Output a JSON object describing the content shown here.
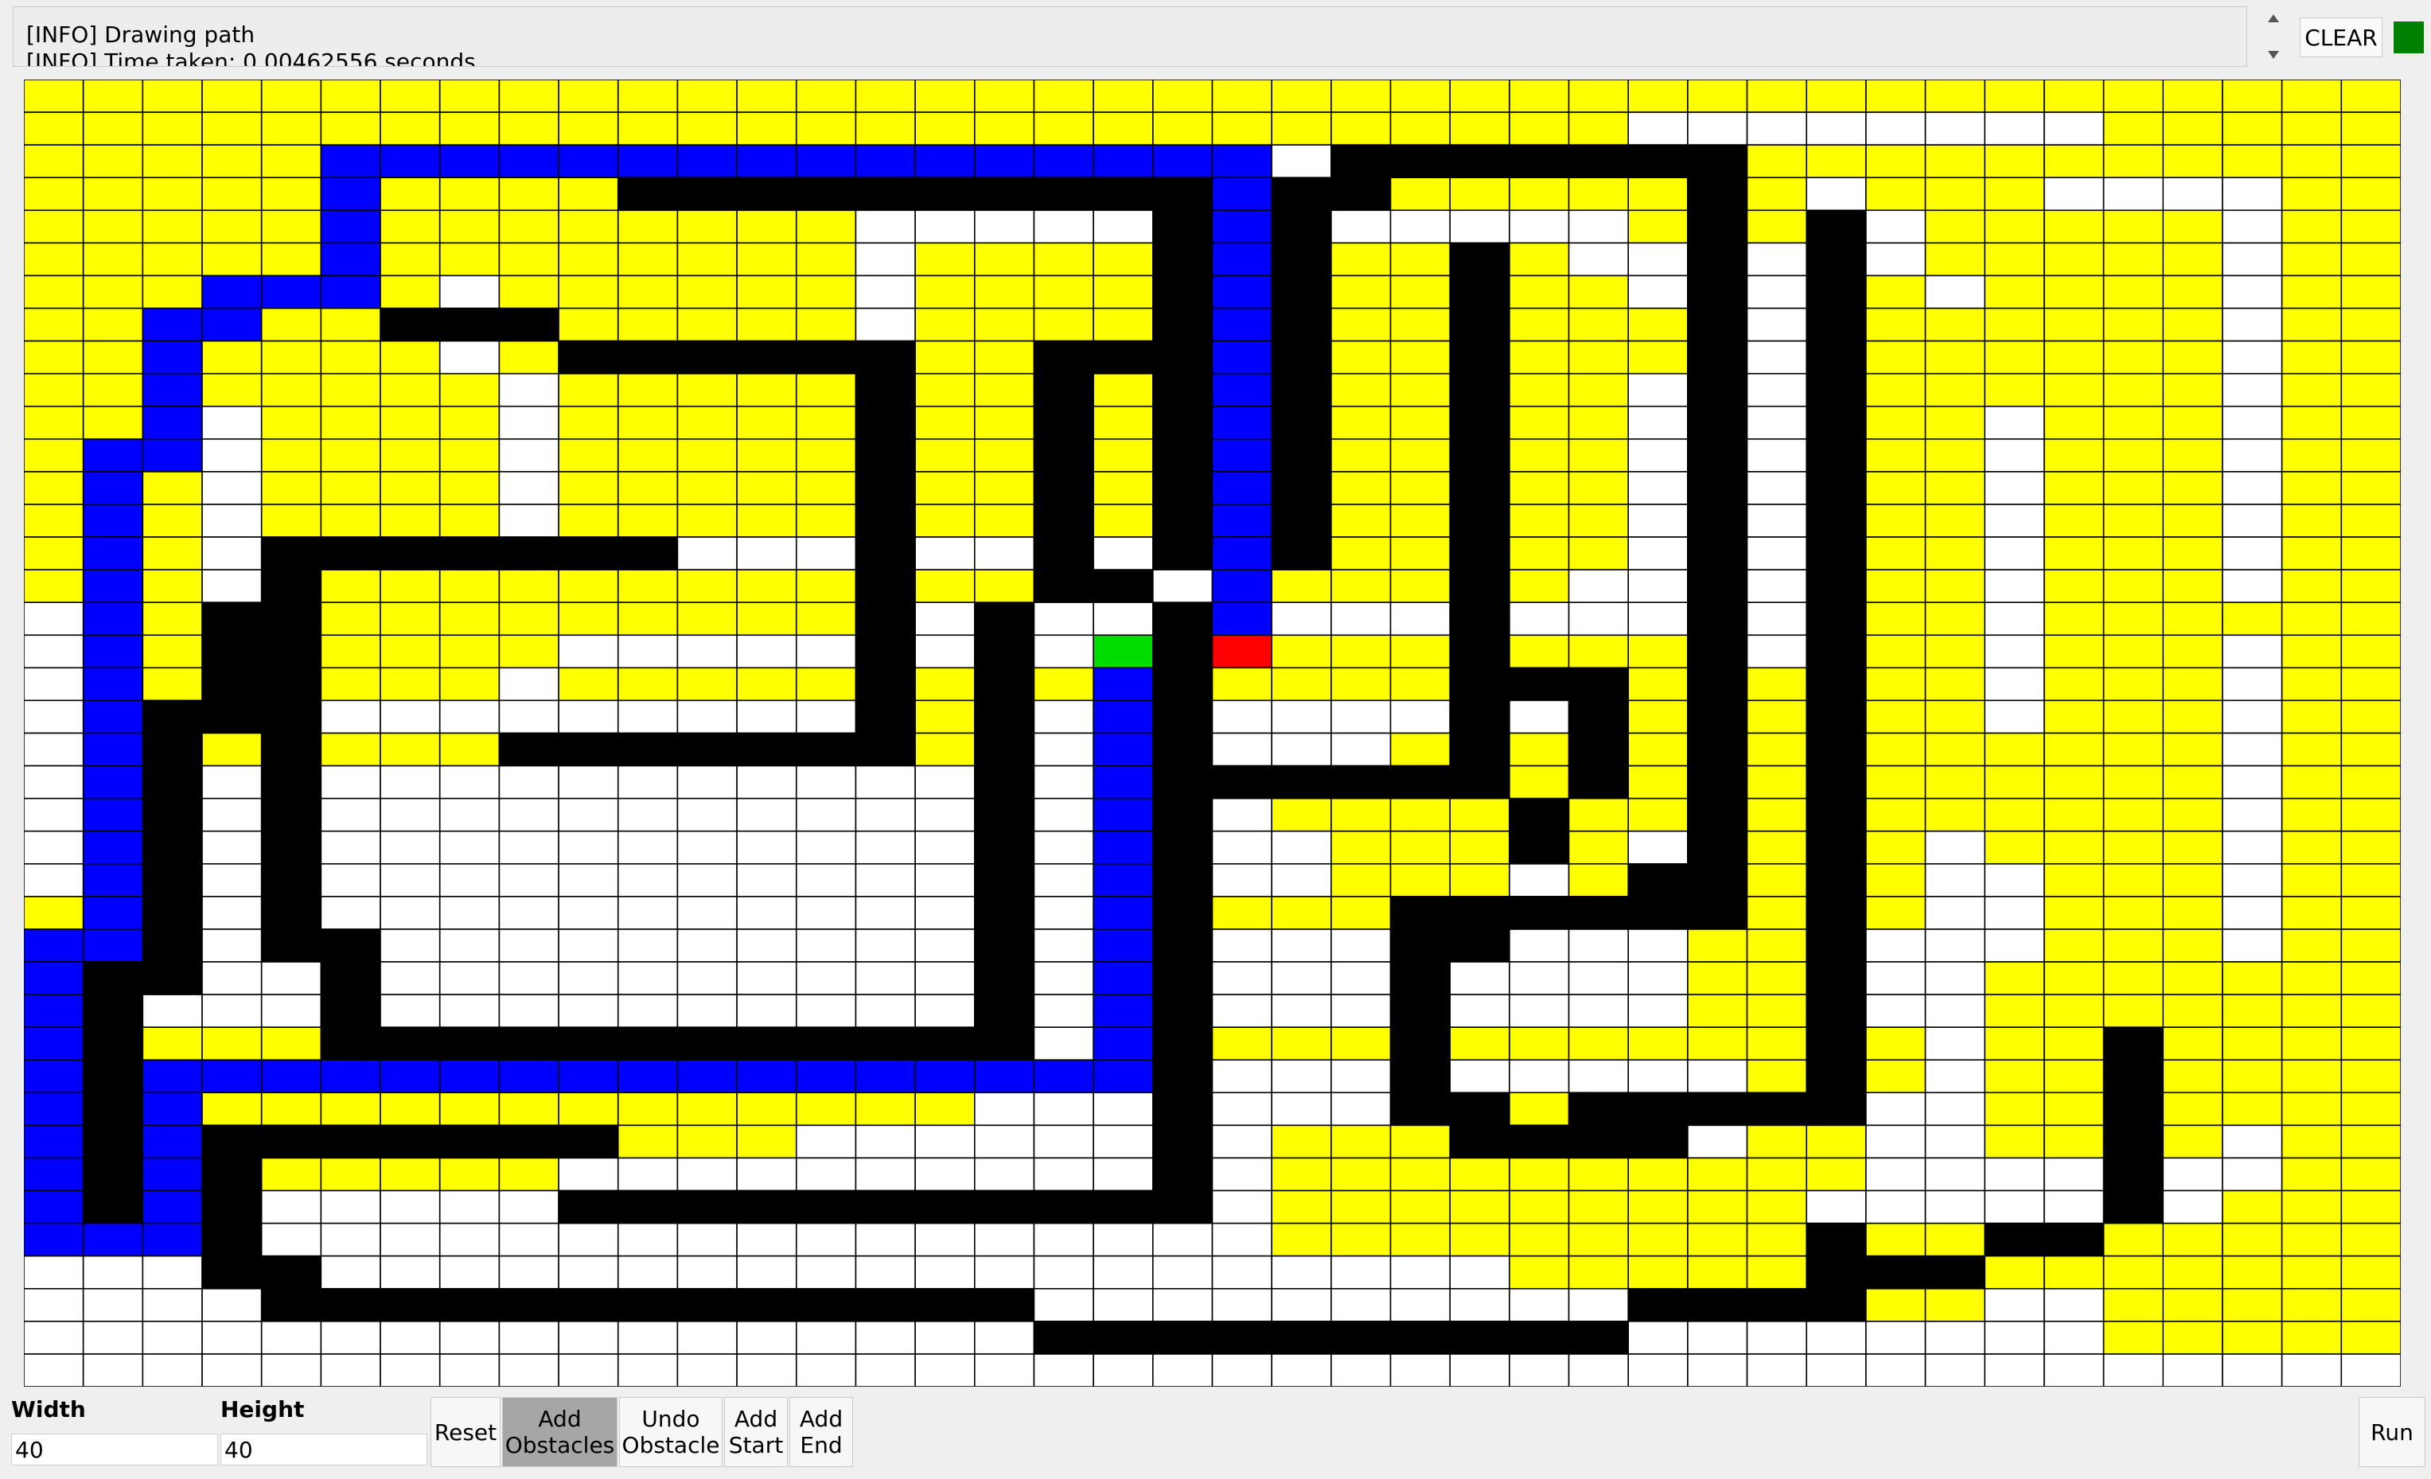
{
  "log": {
    "lines": [
      "[INFO] Drawing path",
      "[INFO] Time taken: 0.00462556 seconds"
    ]
  },
  "toolbar": {
    "clear_label": "CLEAR",
    "status_color": "#008000"
  },
  "controls": {
    "width_label": "Width",
    "width_value": "40",
    "height_label": "Height",
    "height_value": "40",
    "reset_label": "Reset",
    "add_obstacles_line1": "Add",
    "add_obstacles_line2": "Obstacles",
    "undo_line1": "Undo",
    "undo_line2": "Obstacle",
    "add_start_line1": "Add",
    "add_start_line2": "Start",
    "add_end_line1": "Add",
    "add_end_line2": "End",
    "run_label": "Run"
  },
  "grid": {
    "cols": 40,
    "rows": 40,
    "colors": {
      "Y": "#ffff00",
      "W": "#ffffff",
      "K": "#000000",
      "B": "#0000ff",
      "G": "#00dd00",
      "R": "#ff0000"
    },
    "cells": [
      "YYYYYYYYYYYYYYYYYYYYYYYYYYYYYYYYYYYYYYYY",
      "YYYYYYYYYYYYYYYYYYYYYYYYYYYWWWWWWWWYYYYY",
      "YYYYYBBBBBBBBBBBBBBBBWKKKKKKKYYYYYYYYYYY",
      "YYYYYBYYYYKKKKKKKKKKBKKYYYYYKYWYYYWWWWYY",
      "YYYYYBYYYYYYYYWWWWWKBKWWWWWYKYKWYYYYYWYY",
      "YYYYYBYYYYYYYYWYYYYKBKYYKYWWKWKWYYYYYWYY",
      "YYYBBBYWYYYYYYWYYYYKBKYYKYYWKWKYWYYYYWYY",
      "YYBBYYKKKYYYYYWYYYYKBKYYKYYYKWKYYYYYYWYY",
      "YYBYYYYWYKKKKKKYYKKKBKYYKYYYKWKYYYYYYWYY",
      "YYBYYYYYWYYYYYKYYKYKBKYYKYYWKWKYYYYYYWYY",
      "YYBWYYYYWYYYYYKYYKYKBKYYKYYWKWKYYWYYYWYY",
      "YBBWYYYYWYYYYYKYYKYKBKYYKYYWKWKYYWYYYWYY",
      "YBYWYYYYWYYYYYKYYKYKBKYYKYYWKWKYYWYYYWYY",
      "YBYWYYYYWYYYYYKYYKYKBKYYKYYWKWKYYWYYYWYY",
      "YBYWKKKKKKKWWWKWWKWKBKYYKYYWKWKYYWYYYWYY",
      "YBYWKYYYYYYYYYKYYKKWBYYYKYWWKWKYYWYYYWYY",
      "WBYKKYYYYYYYYYKWKWWKBWWWKWWWKWKYYWYYYYYY",
      "WBYKKYYYYWWWWWKWKWGKRYYYKYYYKWKYYWYYYWYY",
      "WBYKKYYYWYYYYYKYKYBKYYYYKKKYKYKYYWYYYWYY",
      "WBKKKWWWWWWWWWKYKWBKWWWWKWKYKYKYYWYYYWYY",
      "WBKYKYYYKKKKKKKYKWBKWWWYKYKYKYKYYYYYYWYY",
      "WBKWKWWWWWWWWWWWKWBKKKKKKYKYKYKYYYYYYWYY",
      "WBKWKWWWWWWWWWWWKWBKWYYYYKYYKYKYYYYYYWYY",
      "WBKWKWWWWWWWWWWWKWBKWWYYYKYWKYKYWYYYYWYY",
      "WBKWKWWWWWWWWWWWKWBKWWYYYWYKKYKYWWYYYWYY",
      "YBKWKWWWWWWWWWWWKWBKYYYKKKKKKYKYWWYYYWYY",
      "BBKWKKWWWWWWWWWWKWBKWWWKKWWWYYKWWWYYYWYY",
      "BKKWWKWWWWWWWWWWKWBKWWWKWWWWYYKWWYYYYYYY",
      "BKWWWKWWWWWWWWWWKWBKWWWKWWWWYYKWWYYYYYYY",
      "BKYYYKKKKKKKKKKKKWBKYYYKYYYYYYKYWYYKYYYY",
      "BKBBBBBBBBBBBBBBBBBKWWWKWWWWWYKYWYYKYYYY",
      "BKBYYYYYYYYYYYYYWWWKWWWKKYKKKKKWWYYKYYYY",
      "BKBKKKKKKKYYYWWWWWWKWYYYKKKKWYYWWYYKYWYY",
      "BKBKYYYYYWWWWWWWWWWKWYYYYYYYYYYWWWWKWWYY",
      "BKBKWWWWWKKKKKKKKKKKWYYYYYYYYYWWWWWKWYYY",
      "BBBKWWWWWWWWWWWWWWWWWYYYYYYYYYKYYKKYYYYY",
      "WWWKKWWWWWWWWWWWWWWWWWWWWYYYYYKKKYYYYYYY",
      "WWWWKKKKKKKKKKKKKWWWWWWWWWWKKKKYYWWYYYYY",
      "WWWWWWWWWWWWWWWWWKKKKKKKKKKWWWWWWWWYYYYY",
      "WWWWWWWWWWWWWWWWWWWWWWWWWWWWWWWWWWWWWWWW"
    ]
  }
}
